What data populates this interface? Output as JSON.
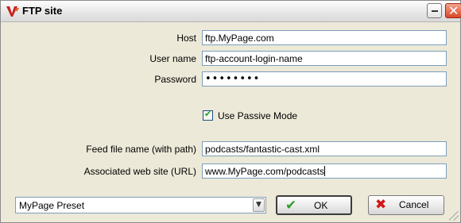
{
  "window": {
    "title": "FTP site"
  },
  "form": {
    "host_label": "Host",
    "host_value": "ftp.MyPage.com",
    "username_label": "User name",
    "username_value": "ftp-account-login-name",
    "password_label": "Password",
    "password_value": "••••••••",
    "passive_mode_label": "Use Passive Mode",
    "passive_mode_checked": true,
    "feed_file_label": "Feed file name (with path)",
    "feed_file_value": "podcasts/fantastic-cast.xml",
    "website_label": "Associated web site (URL)",
    "website_value": "www.MyPage.com/podcasts"
  },
  "footer": {
    "preset_value": "MyPage Preset",
    "ok_label": "OK",
    "cancel_label": "Cancel"
  },
  "icons": {
    "app": "app-logo-icon",
    "minimize": "minimize-icon",
    "close": "close-icon",
    "dropdown": "chevron-down-icon",
    "ok": "checkmark-icon",
    "cancel": "x-icon"
  },
  "colors": {
    "ok_icon": "#2f9e2f",
    "cancel_icon": "#d01818",
    "close_button": "#d8472a",
    "field_border": "#7f9db9"
  }
}
